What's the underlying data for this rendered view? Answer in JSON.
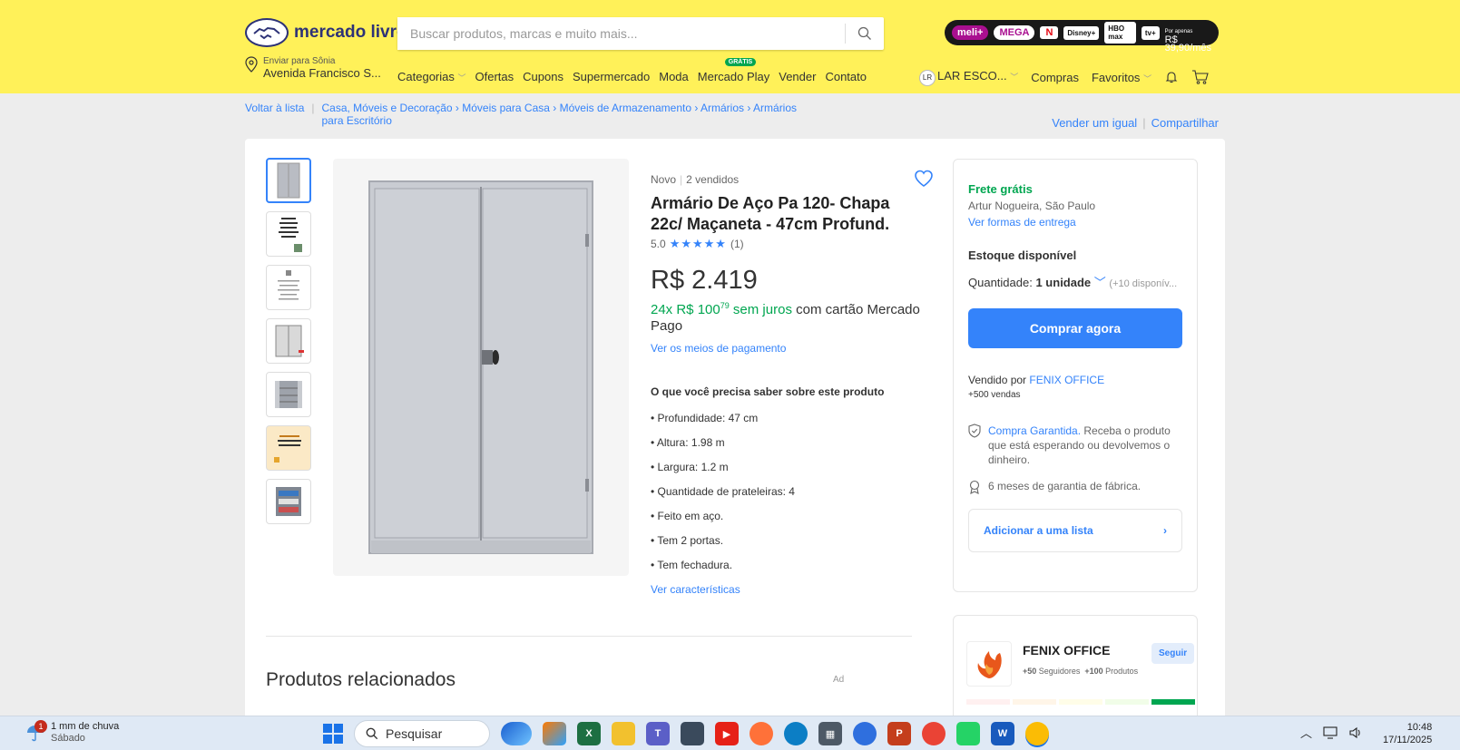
{
  "header": {
    "logo_text": "mercado livre",
    "search_placeholder": "Buscar produtos, marcas e muito mais...",
    "meli": {
      "brand": "meli+",
      "plan": "MEGA",
      "services": [
        "N",
        "Disney+",
        "HBO max",
        "tv+"
      ],
      "price_label": "Por apenas",
      "price": "R$ 39,90/mês"
    },
    "address_label": "Enviar para Sônia",
    "address_value": "Avenida Francisco S...",
    "nav": [
      "Categorias",
      "Ofertas",
      "Cupons",
      "Supermercado",
      "Moda",
      "Mercado Play",
      "Vender",
      "Contato"
    ],
    "play_badge": "GRÁTIS",
    "user_initials": "LR",
    "user_name": "LAR ESCO...",
    "purchases": "Compras",
    "favorites": "Favoritos"
  },
  "breadcrumb": {
    "back": "Voltar à lista",
    "path": "Casa, Móveis e Decoração › Móveis para Casa › Móveis de Armazenamento › Armários › Armários para Escritório",
    "sell_same": "Vender um igual",
    "share": "Compartilhar"
  },
  "product": {
    "condition": "Novo",
    "sold": "2 vendidos",
    "title": "Armário De Aço Pa 120- Chapa 22c/ Maçaneta - 47cm Profund.",
    "rating": "5.0",
    "stars": "★★★★★",
    "reviews": "(1)",
    "price": "R$ 2.419",
    "installments_count": "24x R$ 100",
    "installments_cents": "79",
    "installments_free": "sem juros",
    "installments_card": "com cartão Mercado Pago",
    "payment_link": "Ver os meios de pagamento",
    "know_title": "O que você precisa saber sobre este produto",
    "features": [
      "Profundidade: 47 cm",
      "Altura: 1.98 m",
      "Largura: 1.2 m",
      "Quantidade de prateleiras: 4",
      "Feito em aço.",
      "Tem 2 portas.",
      "Tem fechadura."
    ],
    "see_features": "Ver características",
    "related_title": "Produtos relacionados",
    "ad_label": "Ad"
  },
  "buybox": {
    "shipping": "Frete grátis",
    "city": "Artur Nogueira, São Paulo",
    "delivery_link": "Ver formas de entrega",
    "stock": "Estoque disponível",
    "qty_label": "Quantidade:",
    "qty_value": "1 unidade",
    "qty_available": "(+10 disponív...",
    "buy_button": "Comprar agora",
    "sold_by": "Vendido por",
    "seller": "FENIX OFFICE",
    "seller_sales": "+500 vendas",
    "guarantee_link": "Compra Garantida.",
    "guarantee_text": "Receba o produto que está esperando ou devolvemos o dinheiro.",
    "warranty": "6 meses de garantia de fábrica.",
    "add_list": "Adicionar a uma lista"
  },
  "seller_card": {
    "name": "FENIX OFFICE",
    "follow": "Seguir",
    "followers": "+50",
    "followers_label": "Seguidores",
    "products": "+100",
    "products_label": "Produtos",
    "thermometer_colors": [
      "#fff0f0",
      "#fff5e8",
      "#fffde8",
      "#f1fde8",
      "#00a650"
    ]
  },
  "taskbar": {
    "weather_badge": "1",
    "weather": "1 mm de chuva",
    "weather_day": "Sábado",
    "search": "Pesquisar",
    "time": "10:48",
    "date": "17/11/2025"
  },
  "colors": {
    "brand_yellow": "#fff159",
    "accent_blue": "#3483fa",
    "success_green": "#00a650"
  }
}
